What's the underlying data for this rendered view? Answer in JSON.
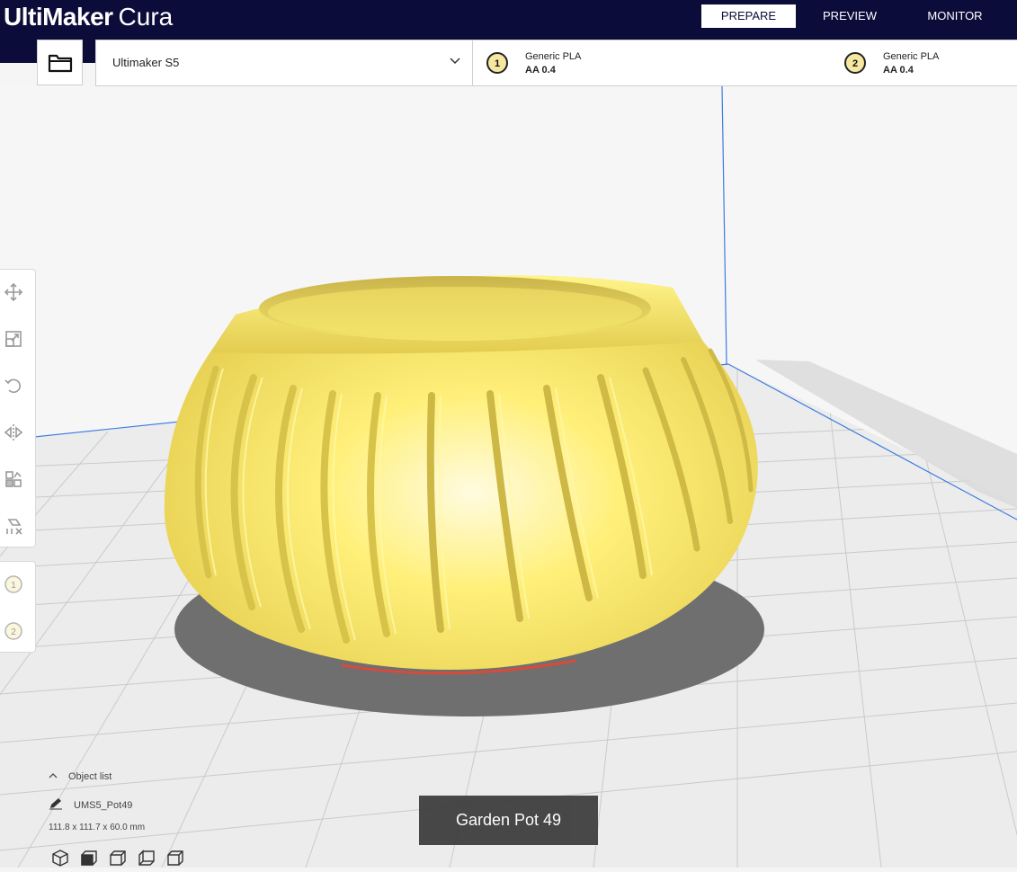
{
  "app": {
    "brand_bold": "UltiMaker",
    "brand_light": "Cura"
  },
  "stage_tabs": [
    {
      "label": "PREPARE",
      "active": true
    },
    {
      "label": "PREVIEW",
      "active": false
    },
    {
      "label": "MONITOR",
      "active": false
    }
  ],
  "printer": {
    "name": "Ultimaker S5"
  },
  "extruders": [
    {
      "number": "1",
      "material": "Generic PLA",
      "nozzle": "AA 0.4"
    },
    {
      "number": "2",
      "material": "Generic PLA",
      "nozzle": "AA 0.4"
    }
  ],
  "toolbar": {
    "tools": [
      "move-icon",
      "scale-icon",
      "rotate-icon",
      "mirror-icon",
      "per-model-settings-icon",
      "support-blocker-icon"
    ],
    "extruder_buttons": [
      "1",
      "2"
    ]
  },
  "object_list": {
    "toggle_label": "Object list",
    "object_name": "UMS5_Pot49",
    "dimensions": "111.8 x 111.7 x 60.0 mm"
  },
  "view_buttons": [
    "3d-view-icon",
    "front-view-icon",
    "top-view-icon",
    "left-view-icon",
    "right-view-icon"
  ],
  "job": {
    "name": "Garden Pot 49"
  },
  "colors": {
    "header": "#0c0c3a",
    "model": "#f5e66a",
    "build_plate": "#e9e9e9",
    "grid_line": "#c9c9c9",
    "axis_blue": "#3b7de0"
  }
}
